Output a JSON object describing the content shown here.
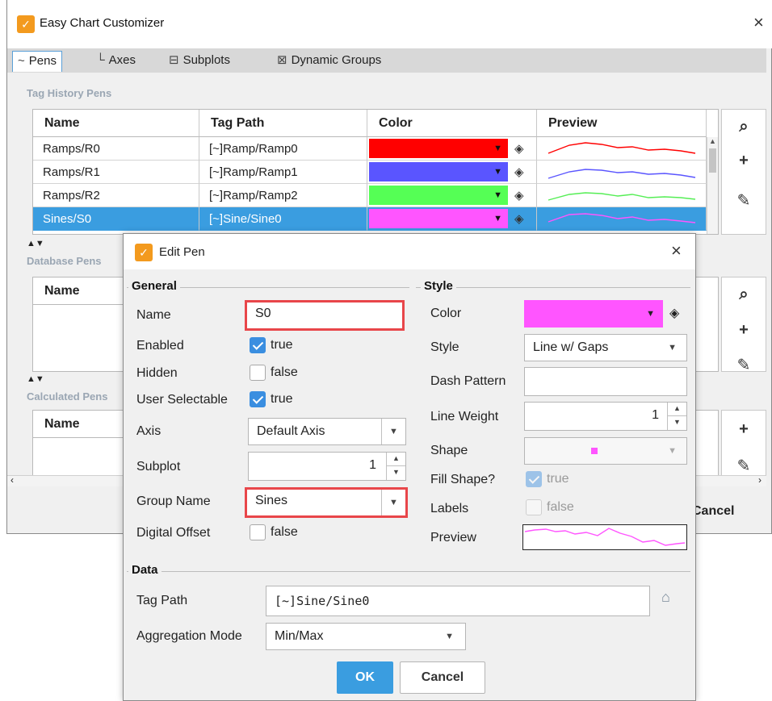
{
  "window": {
    "title": "Easy Chart Customizer",
    "close": "×"
  },
  "tabs": [
    {
      "label": "Pens",
      "icon": "~"
    },
    {
      "label": "Axes",
      "icon": "└"
    },
    {
      "label": "Subplots",
      "icon": "⊟"
    },
    {
      "label": "Dynamic Groups",
      "icon": "⊠"
    }
  ],
  "tag_history": {
    "label": "Tag History Pens",
    "columns": [
      "Name",
      "Tag Path",
      "Color",
      "Preview"
    ],
    "rows": [
      {
        "name": "Ramps/R0",
        "path": "[~]Ramp/Ramp0",
        "color": "#ff0000"
      },
      {
        "name": "Ramps/R1",
        "path": "[~]Ramp/Ramp1",
        "color": "#5a55ff"
      },
      {
        "name": "Ramps/R2",
        "path": "[~]Ramp/Ramp2",
        "color": "#55ff55"
      },
      {
        "name": "Sines/S0",
        "path": "[~]Sine/Sine0",
        "color": "#ff55ff"
      }
    ]
  },
  "database_pens": {
    "label": "Database Pens",
    "columns": [
      "Name"
    ]
  },
  "calculated_pens": {
    "label": "Calculated Pens",
    "columns": [
      "Name"
    ]
  },
  "bg_cancel": "Cancel",
  "edit_pen": {
    "title": "Edit Pen",
    "close": "×",
    "general": {
      "title": "General",
      "name_label": "Name",
      "name_value": "S0",
      "enabled_label": "Enabled",
      "enabled_value": "true",
      "hidden_label": "Hidden",
      "hidden_value": "false",
      "user_selectable_label": "User Selectable",
      "user_selectable_value": "true",
      "axis_label": "Axis",
      "axis_value": "Default Axis",
      "subplot_label": "Subplot",
      "subplot_value": "1",
      "group_name_label": "Group Name",
      "group_name_value": "Sines",
      "digital_offset_label": "Digital Offset",
      "digital_offset_value": "false"
    },
    "style": {
      "title": "Style",
      "color_label": "Color",
      "color_value": "#ff55ff",
      "style_label": "Style",
      "style_value": "Line w/ Gaps",
      "dash_pattern_label": "Dash Pattern",
      "dash_pattern_value": "",
      "line_weight_label": "Line Weight",
      "line_weight_value": "1",
      "shape_label": "Shape",
      "fill_shape_label": "Fill Shape?",
      "fill_shape_value": "true",
      "labels_label": "Labels",
      "labels_value": "false",
      "preview_label": "Preview"
    },
    "data": {
      "title": "Data",
      "tag_path_label": "Tag Path",
      "tag_path_value": "[~]Sine/Sine0",
      "aggregation_label": "Aggregation Mode",
      "aggregation_value": "Min/Max"
    },
    "ok": "OK",
    "cancel": "Cancel"
  }
}
